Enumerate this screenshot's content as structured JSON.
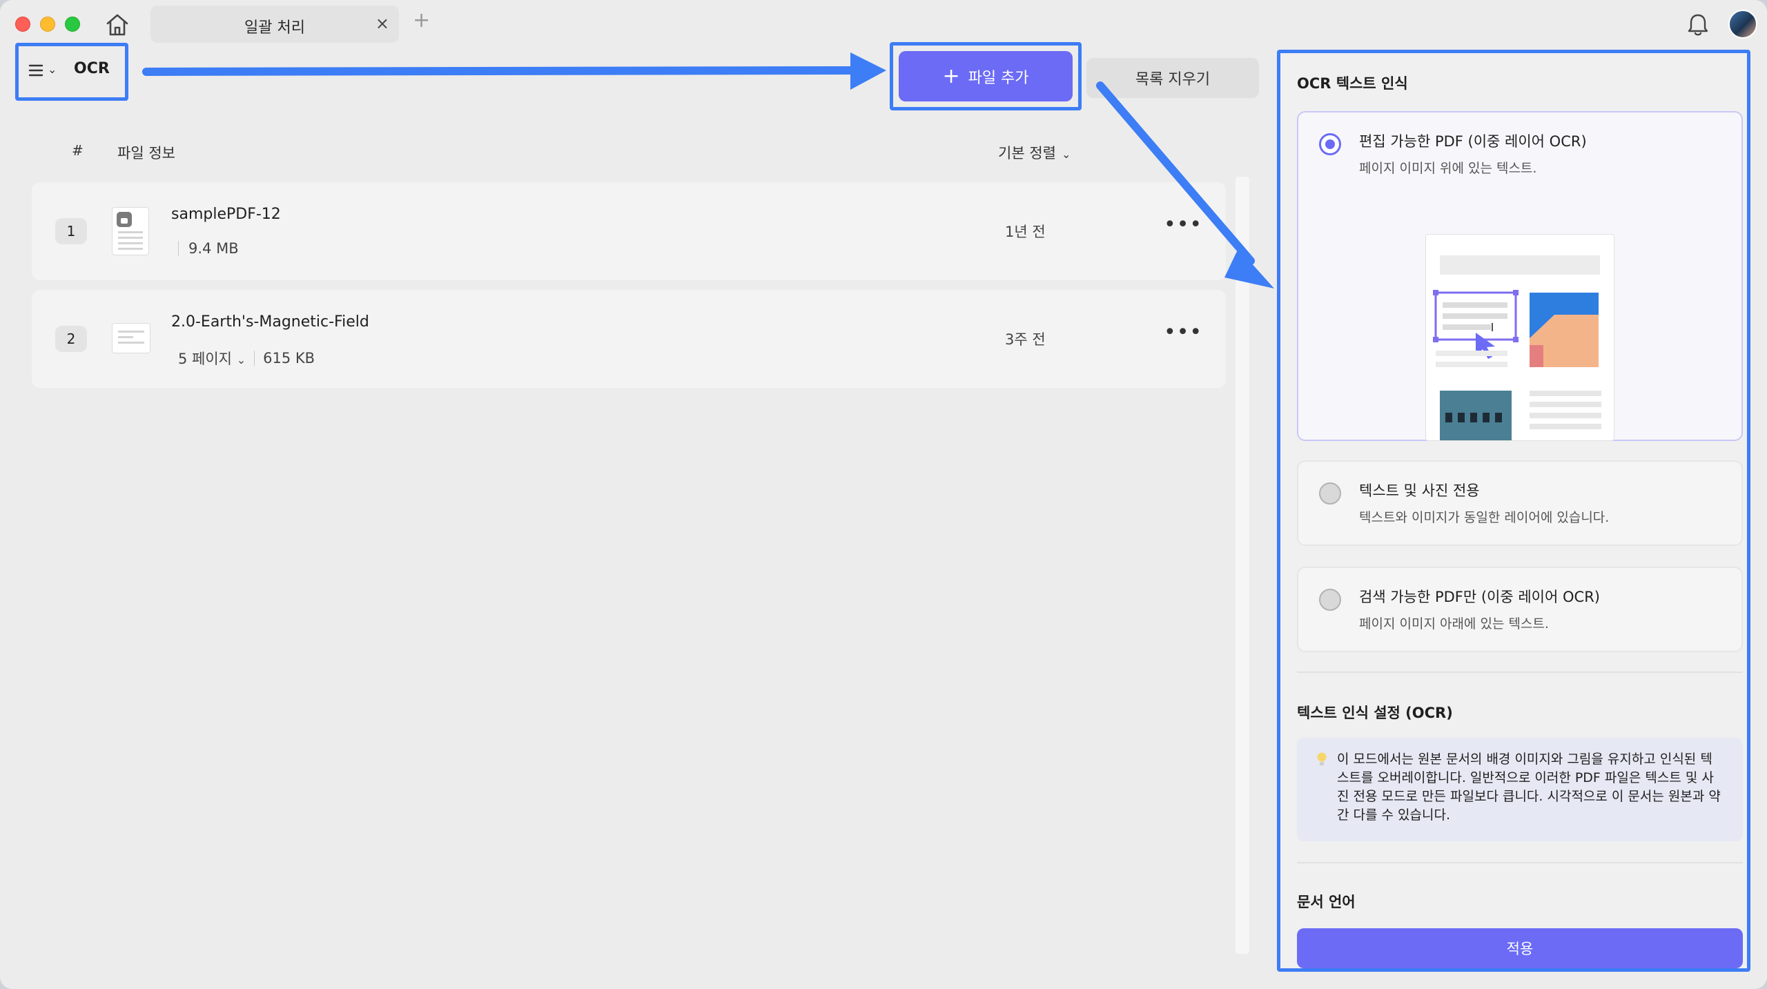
{
  "tab": {
    "title": "일괄 처리",
    "close": "×",
    "add": "+"
  },
  "toolbar": {
    "menu_label": "OCR",
    "menu_chevron": "⌄",
    "add_plus": "+",
    "add_file": "파일 추가",
    "clear_list": "목록 지우기"
  },
  "list": {
    "header_num": "#",
    "header_info": "파일 정보",
    "sort_label": "기본 정렬",
    "sort_chevron": "⌄",
    "files": [
      {
        "num": "1",
        "name": "samplePDF-12",
        "size": "9.4 MB",
        "time": "1년 전",
        "more": "•••",
        "locked": true
      },
      {
        "num": "2",
        "name": "2.0-Earth's-Magnetic-Field",
        "pages": "5 페이지",
        "pages_chevron": "⌄",
        "size": "615 KB",
        "time": "3주 전",
        "more": "•••",
        "locked": false
      }
    ]
  },
  "panel": {
    "title": "OCR 텍스트 인식",
    "options": [
      {
        "title": "편집 가능한 PDF (이중 레이어 OCR)",
        "desc": "페이지 이미지 위에 있는 텍스트.",
        "selected": true
      },
      {
        "title": "텍스트 및 사진 전용",
        "desc": "텍스트와 이미지가 동일한 레이어에 있습니다.",
        "selected": false
      },
      {
        "title": "검색 가능한 PDF만 (이중 레이어 OCR)",
        "desc": "페이지 이미지 아래에 있는 텍스트.",
        "selected": false
      }
    ],
    "settings_title": "텍스트 인식 설정 (OCR)",
    "info_text": "이 모드에서는 원본 문서의 배경 이미지와 그림을 유지하고 인식된 텍스트를 오버레이합니다. 일반적으로 이러한 PDF 파일은 텍스트 및 사진 전용 모드로 만든 파일보다 큽니다. 시각적으로 이 문서는 원본과 약간 다를 수 있습니다.",
    "language_title": "문서 언어",
    "apply": "적용"
  },
  "icons": {
    "home": "home-icon",
    "bell": "bell-icon",
    "menu": "hamburger-menu-icon",
    "bulb": "lightbulb-icon",
    "lock": "lock-icon"
  },
  "colors": {
    "accent": "#6b6bf5",
    "annotation_blue": "#3d7df5"
  }
}
